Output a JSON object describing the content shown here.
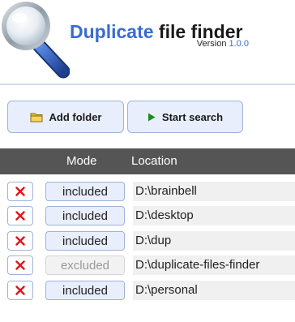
{
  "app": {
    "title_accent": "Duplicate",
    "title_rest": "file finder",
    "version_label": "Version",
    "version_number": "1.0.0",
    "logo_icon": "magnifier-icon"
  },
  "toolbar": {
    "add_folder_label": "Add folder",
    "add_folder_icon": "folder-icon",
    "start_search_label": "Start search",
    "start_search_icon": "play-icon"
  },
  "table": {
    "headers": {
      "mode": "Mode",
      "location": "Location"
    },
    "rows": [
      {
        "mode": "included",
        "location": "D:\\brainbell"
      },
      {
        "mode": "included",
        "location": "D:\\desktop"
      },
      {
        "mode": "included",
        "location": "D:\\dup"
      },
      {
        "mode": "excluded",
        "location": "D:\\duplicate-files-finder"
      },
      {
        "mode": "included",
        "location": "D:\\personal"
      }
    ],
    "remove_icon": "close-icon"
  },
  "colors": {
    "accent": "#3b6bd1",
    "remove": "#e0141b",
    "header_bg": "#555555",
    "button_bg": "#e8eefb"
  }
}
